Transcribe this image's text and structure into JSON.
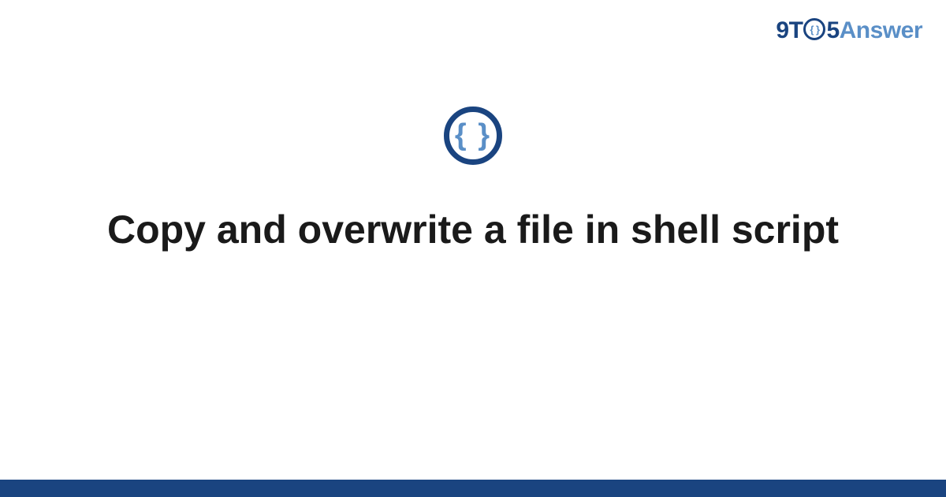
{
  "logo": {
    "nine": "9",
    "t": "T",
    "o_inner": "{ }",
    "five": "5",
    "answer": "Answer"
  },
  "center_icon": {
    "braces": "{ }"
  },
  "title": "Copy and overwrite a file in shell script",
  "colors": {
    "primary_dark": "#1a4480",
    "primary_light": "#5a8fc7",
    "text": "#1a1a1a",
    "background": "#ffffff"
  }
}
